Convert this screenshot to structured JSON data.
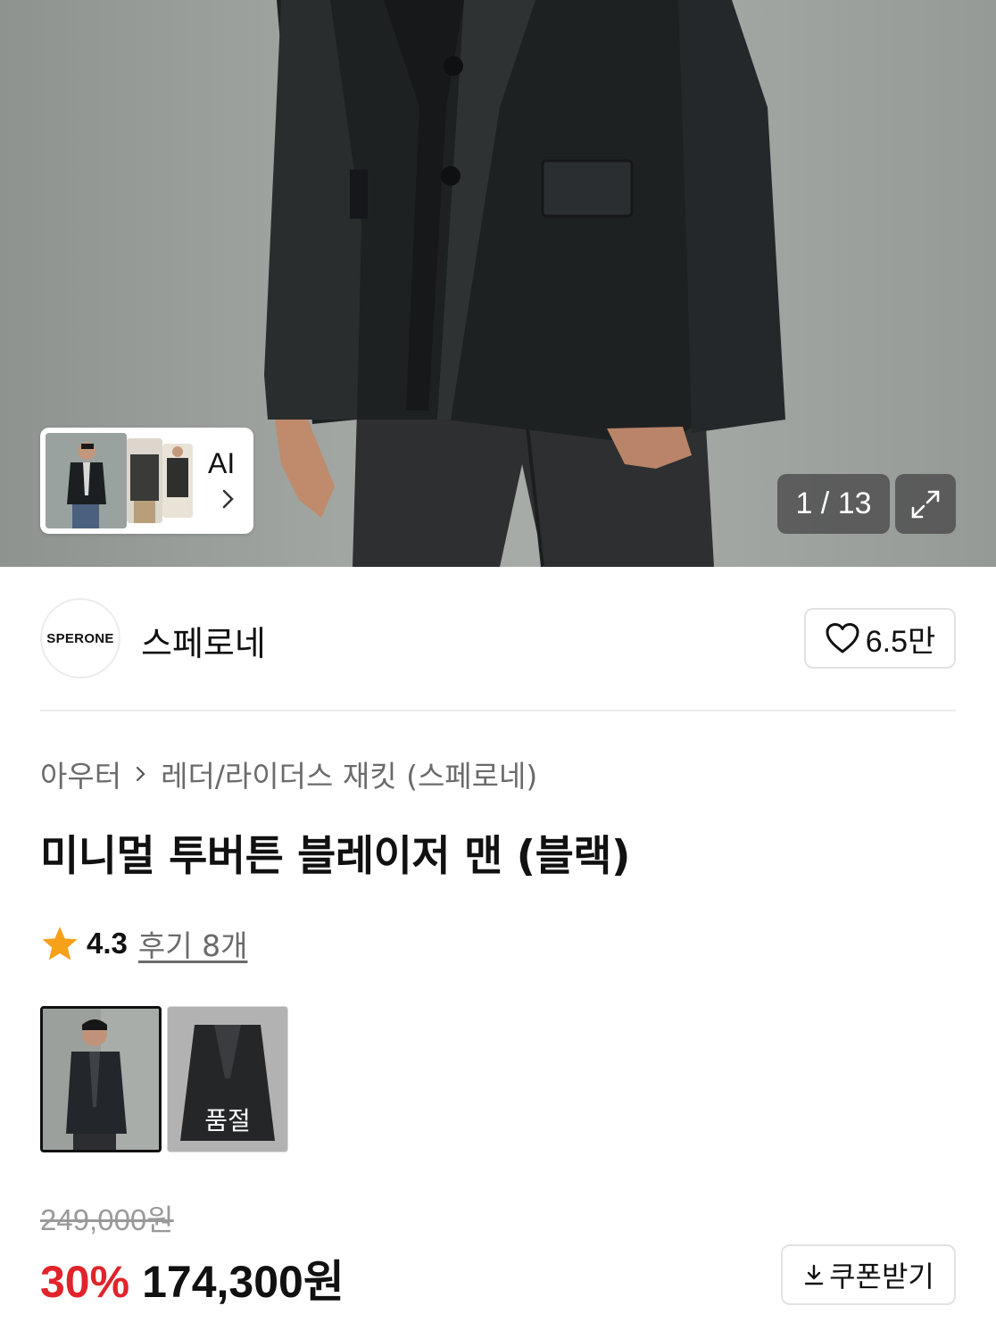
{
  "gallery": {
    "counter": "1 / 13",
    "ai_label": "AI",
    "icons": {
      "expand": "expand-icon",
      "next": "chevron-right-icon"
    }
  },
  "brand": {
    "logo_text": "SPERONE",
    "name": "스페로네",
    "likes": "6.5만",
    "like_icon": "heart-icon"
  },
  "product": {
    "breadcrumb": [
      "아우터",
      "레더/라이더스 재킷 (스페로네)"
    ],
    "title": "미니멀 투버튼 블레이저 맨 (블랙)",
    "rating": "4.3",
    "review_link": "후기 8개",
    "options": [
      {
        "selected": true,
        "sold_out_label": ""
      },
      {
        "selected": false,
        "sold_out_label": "품절"
      }
    ],
    "original_price": "249,000원",
    "discount": "30%",
    "sale_price_number": "174,300",
    "sale_price_unit": "원",
    "coupon_button": "쿠폰받기"
  },
  "colors": {
    "accent_red": "#e0242b",
    "star": "#f7a11a",
    "text": "#111111",
    "muted": "#6b6b6b"
  }
}
